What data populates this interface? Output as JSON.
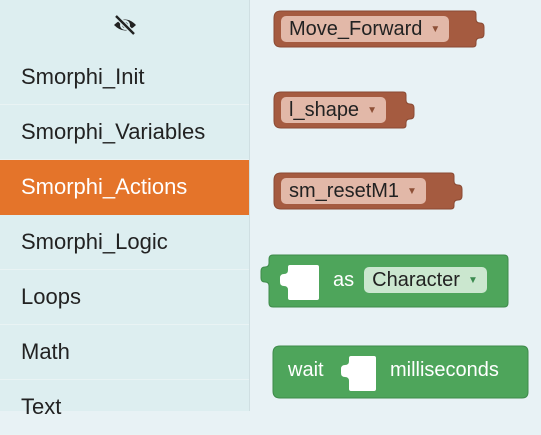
{
  "toolbar": {
    "visibility_icon": "eye-off-icon"
  },
  "categories": [
    {
      "label": "Smorphi_Init",
      "selected": false
    },
    {
      "label": "Smorphi_Variables",
      "selected": false
    },
    {
      "label": "Smorphi_Actions",
      "selected": true
    },
    {
      "label": "Smorphi_Logic",
      "selected": false
    },
    {
      "label": "Loops",
      "selected": false
    },
    {
      "label": "Math",
      "selected": false
    },
    {
      "label": "Text",
      "selected": false
    }
  ],
  "blocks": {
    "move_forward": {
      "dropdown": "Move_Forward",
      "color": "#a55b40"
    },
    "l_shape": {
      "dropdown": "l_shape",
      "color": "#a55b40"
    },
    "sm_reset": {
      "dropdown": "sm_resetM1",
      "color": "#a55b40"
    },
    "as_character": {
      "label": "as",
      "dropdown": "Character",
      "color": "#4ea55b"
    },
    "wait": {
      "label": "wait",
      "suffix": "milliseconds",
      "color": "#4ea55b"
    }
  },
  "colors": {
    "selected_category": "#e4742a",
    "sidebar_bg": "#ddeef0",
    "workspace_bg": "#e8f2f5"
  }
}
